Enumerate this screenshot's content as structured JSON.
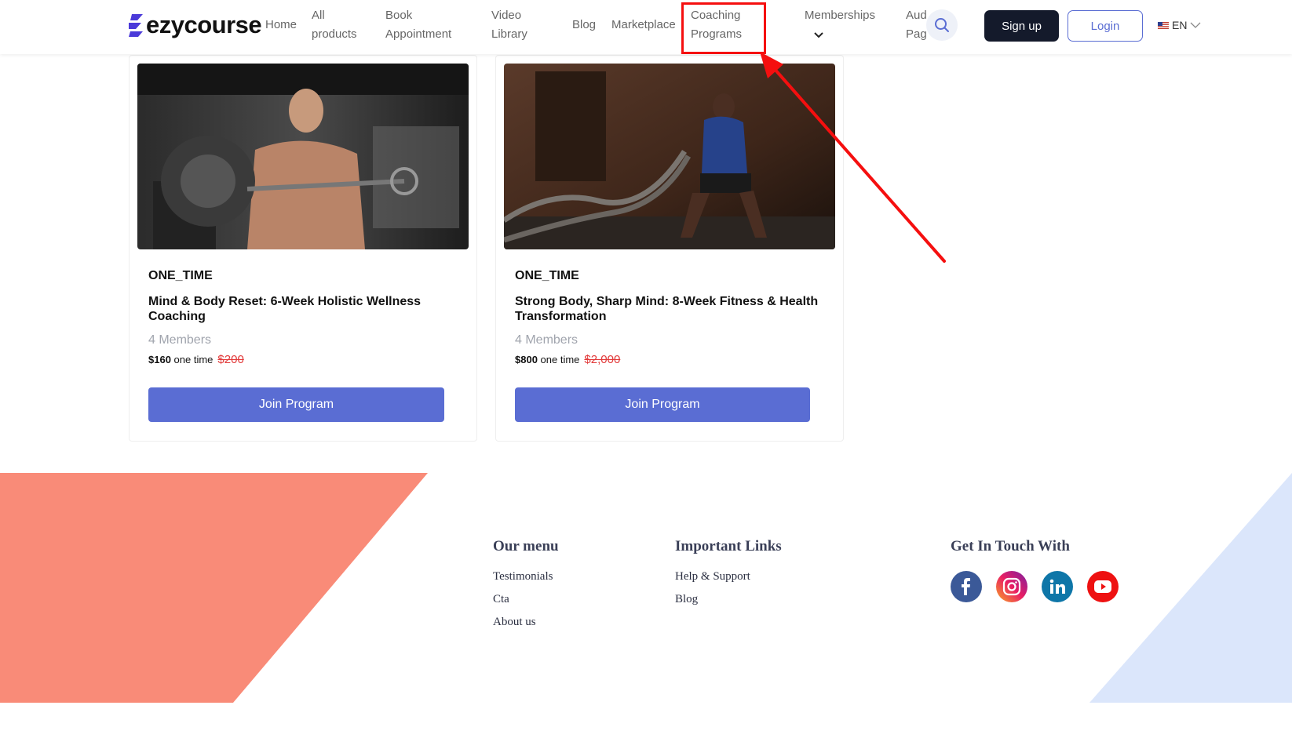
{
  "brand": {
    "name": "ezycourse"
  },
  "nav": {
    "home": "Home",
    "all_products_1": "All",
    "all_products_2": "products",
    "book_1": "Book",
    "book_2": "Appointment",
    "video_1": "Video",
    "video_2": "Library",
    "blog": "Blog",
    "marketplace": "Marketplace",
    "coaching_1": "Coaching",
    "coaching_2": "Programs",
    "memberships": "Memberships",
    "audio_1": "Aud",
    "audio_2": "Pag"
  },
  "header": {
    "signup_label": "Sign up",
    "login_label": "Login",
    "language": "EN"
  },
  "cards": [
    {
      "type": "ONE_TIME",
      "title": "Mind & Body Reset: 6-Week Holistic Wellness Coaching",
      "members": "4 Members",
      "price": "$160",
      "price_suffix": "one time",
      "old_price": "$200",
      "button": "Join Program"
    },
    {
      "type": "ONE_TIME",
      "title": "Strong Body, Sharp Mind: 8-Week Fitness & Health Transformation",
      "members": "4 Members",
      "price": "$800",
      "price_suffix": "one time",
      "old_price": "$2,000",
      "button": "Join Program"
    }
  ],
  "footer": {
    "our_menu_title": "Our menu",
    "our_menu": [
      "Testimonials",
      "Cta",
      "About us"
    ],
    "important_title": "Important Links",
    "important": [
      "Help & Support",
      "Blog"
    ],
    "contact_title": "Get In Touch With",
    "social_icons": [
      "facebook-icon",
      "instagram-icon",
      "linkedin-icon",
      "youtube-icon"
    ]
  },
  "colors": {
    "primary": "#5a6dd3",
    "dark_button": "#141a2b",
    "annotation": "#f50f0f",
    "footer_coral": "#f98b78",
    "footer_blue": "#dbe6fb",
    "old_price": "#e23a3a"
  }
}
